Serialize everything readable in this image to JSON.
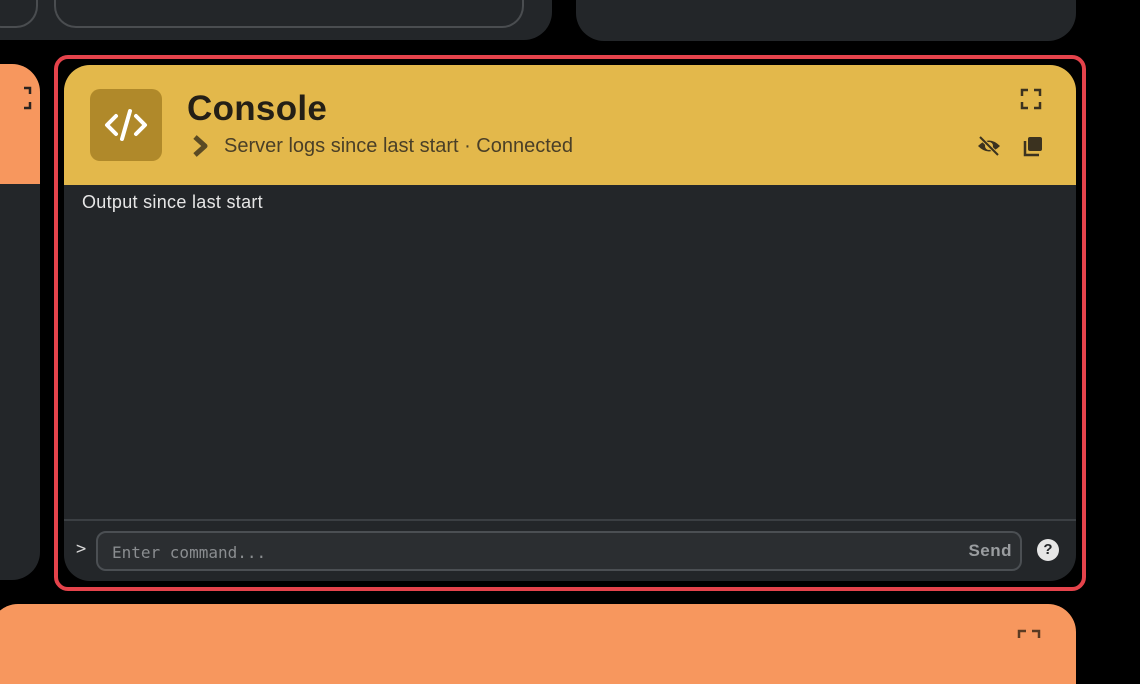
{
  "console": {
    "title": "Console",
    "subtitle": "Server logs since last start · Connected",
    "log_lines": [
      "Output since last start"
    ],
    "prompt": ">",
    "input_placeholder": "Enter command...",
    "input_value": "",
    "send_label": "Send",
    "help_label": "?",
    "header_color": "#e3b84b",
    "icon_bg": "#b0892a",
    "icons": {
      "app": "code-icon",
      "subtitle": "chevron-right-icon",
      "expand": "fullscreen-icon",
      "hide": "eye-off-icon",
      "copy": "copy-icon",
      "help": "help-icon"
    }
  },
  "neighbors": {
    "accent_color": "#f7975e",
    "card_color": "#232629",
    "focus_ring_color": "#e5434b"
  }
}
